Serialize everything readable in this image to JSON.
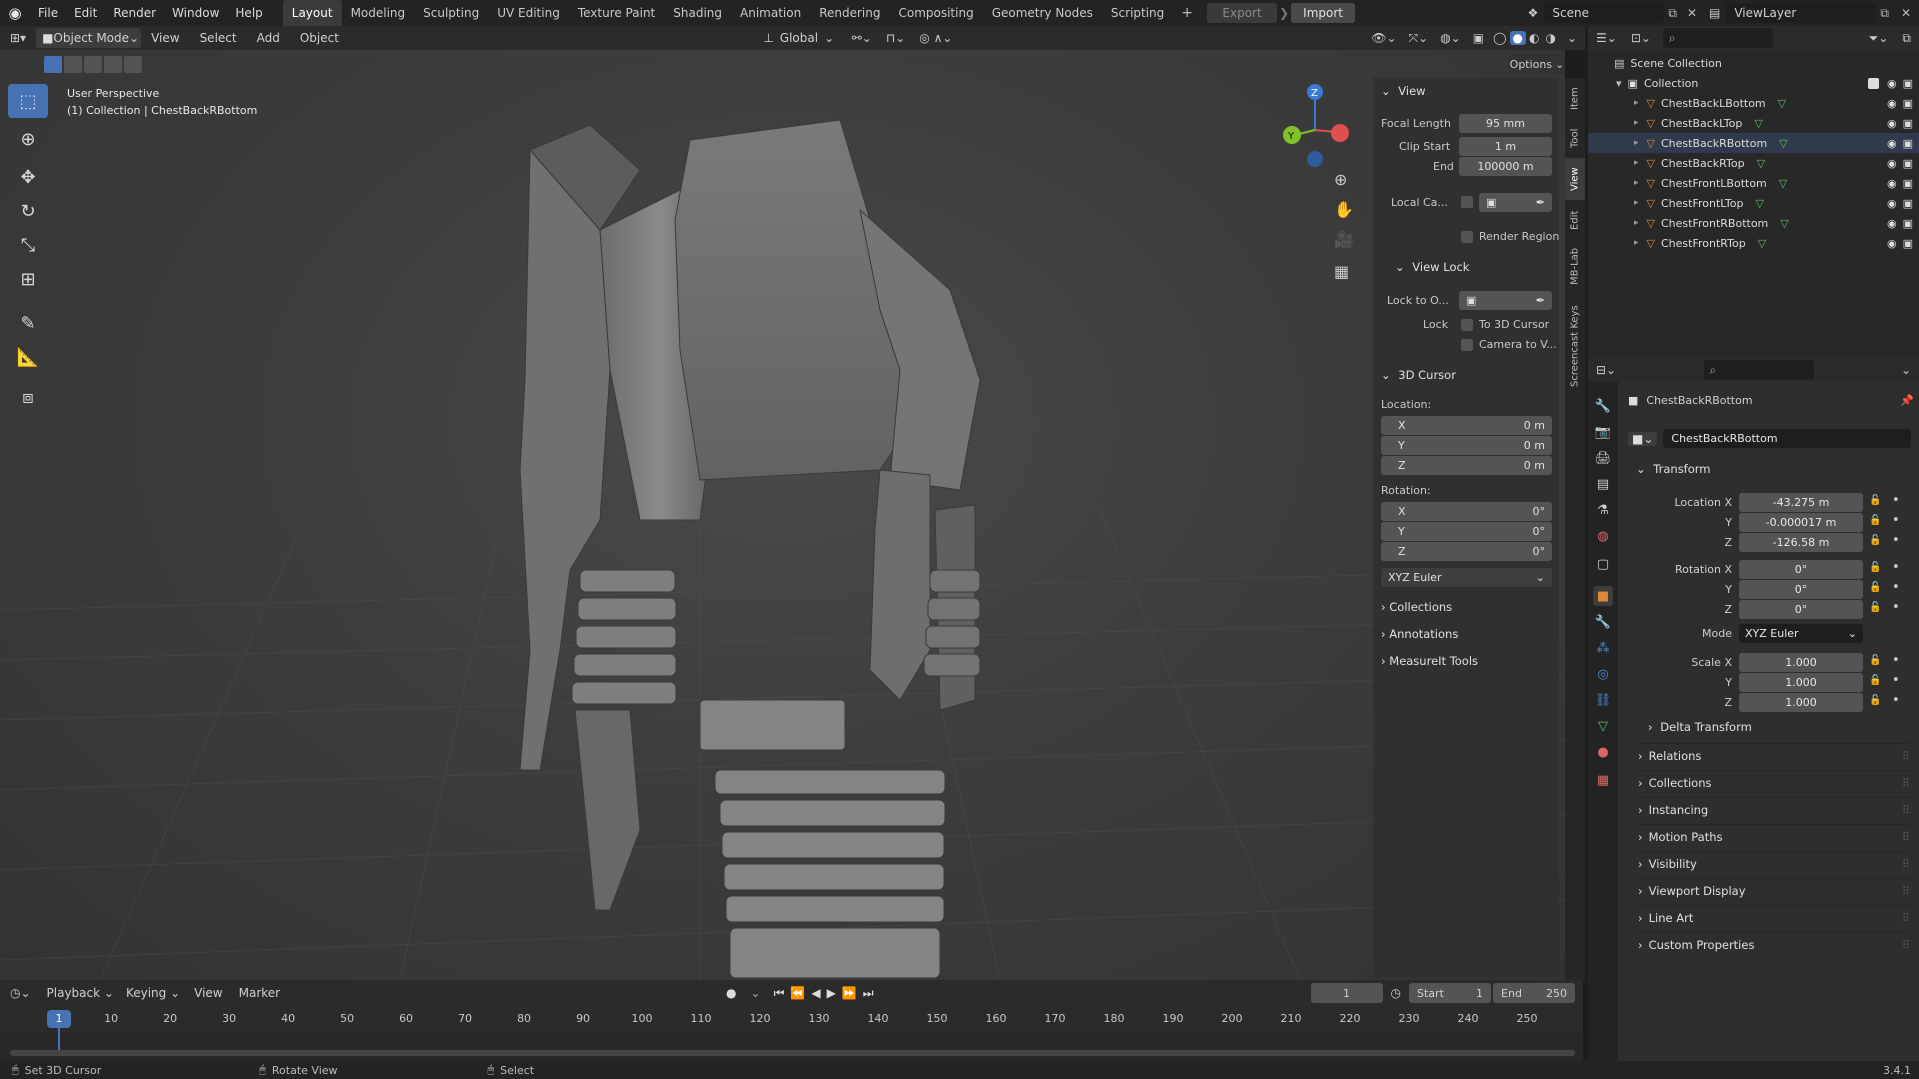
{
  "topbar": {
    "menus": [
      "File",
      "Edit",
      "Render",
      "Window",
      "Help"
    ],
    "workspaces": [
      "Layout",
      "Modeling",
      "Sculpting",
      "UV Editing",
      "Texture Paint",
      "Shading",
      "Animation",
      "Rendering",
      "Compositing",
      "Geometry Nodes",
      "Scripting"
    ],
    "active_workspace": "Layout",
    "export_label": "Export",
    "import_label": "Import",
    "scene": "Scene",
    "view_layer": "ViewLayer"
  },
  "viewport_header": {
    "mode": "Object Mode",
    "menus": [
      "View",
      "Select",
      "Add",
      "Object"
    ],
    "orientation": "Global",
    "options_label": "Options"
  },
  "viewport": {
    "perspective": "User Perspective",
    "context": "(1) Collection | ChestBackRBottom",
    "gizmo_axes": {
      "x": "X",
      "y": "Y",
      "z": "Z"
    }
  },
  "npanel": {
    "tabs": [
      "Item",
      "Tool",
      "View",
      "Edit",
      "MB-Lab",
      "Screencast Keys"
    ],
    "view": {
      "title": "View",
      "focal_length_label": "Focal Length",
      "focal_length": "95 mm",
      "clip_start_label": "Clip Start",
      "clip_start": "1 m",
      "end_label": "End",
      "clip_end": "100000 m",
      "local_camera_label": "Local Ca...",
      "render_region_label": "Render Region"
    },
    "view_lock": {
      "title": "View Lock",
      "lock_to_label": "Lock to O...",
      "lock_label": "Lock",
      "to_3d_cursor": "To 3D Cursor",
      "camera_to_view": "Camera to V..."
    },
    "cursor": {
      "title": "3D Cursor",
      "location_label": "Location:",
      "location": [
        {
          "axis": "X",
          "value": "0 m"
        },
        {
          "axis": "Y",
          "value": "0 m"
        },
        {
          "axis": "Z",
          "value": "0 m"
        }
      ],
      "rotation_label": "Rotation:",
      "rotation": [
        {
          "axis": "X",
          "value": "0°"
        },
        {
          "axis": "Y",
          "value": "0°"
        },
        {
          "axis": "Z",
          "value": "0°"
        }
      ],
      "rotation_mode": "XYZ Euler"
    },
    "collapsed": [
      "Collections",
      "Annotations",
      "MeasureIt Tools"
    ]
  },
  "outliner": {
    "scene_collection": "Scene Collection",
    "collection": "Collection",
    "objects": [
      "ChestBackLBottom",
      "ChestBackLTop",
      "ChestBackRBottom",
      "ChestBackRTop",
      "ChestFrontLBottom",
      "ChestFrontLTop",
      "ChestFrontRBottom",
      "ChestFrontRTop"
    ],
    "active_object": "ChestBackRBottom"
  },
  "properties": {
    "object_name": "ChestBackRBottom",
    "object_field": "ChestBackRBottom",
    "transform_label": "Transform",
    "location": [
      {
        "label": "Location X",
        "value": "-43.275 m"
      },
      {
        "label": "Y",
        "value": "-0.000017 m"
      },
      {
        "label": "Z",
        "value": "-126.58 m"
      }
    ],
    "rotation": [
      {
        "label": "Rotation X",
        "value": "0°"
      },
      {
        "label": "Y",
        "value": "0°"
      },
      {
        "label": "Z",
        "value": "0°"
      }
    ],
    "mode_label": "Mode",
    "mode": "XYZ Euler",
    "scale": [
      {
        "label": "Scale X",
        "value": "1.000"
      },
      {
        "label": "Y",
        "value": "1.000"
      },
      {
        "label": "Z",
        "value": "1.000"
      }
    ],
    "delta_transform": "Delta Transform",
    "sections": [
      "Relations",
      "Collections",
      "Instancing",
      "Motion Paths",
      "Visibility",
      "Viewport Display",
      "Line Art",
      "Custom Properties"
    ]
  },
  "timeline": {
    "menus": [
      "Playback",
      "Keying",
      "View",
      "Marker"
    ],
    "current_frame": "1",
    "start_label": "Start",
    "start": "1",
    "end_label": "End",
    "end": "250",
    "ruler_frames": [
      "10",
      "20",
      "30",
      "40",
      "50",
      "60",
      "70",
      "80",
      "90",
      "100",
      "110",
      "120",
      "130",
      "140",
      "150",
      "160",
      "170",
      "180",
      "190",
      "200",
      "210",
      "220",
      "230",
      "240",
      "250"
    ],
    "playhead_label": "1"
  },
  "statusbar": {
    "items": [
      "Set 3D Cursor",
      "Rotate View",
      "Select"
    ],
    "version": "3.4.1"
  },
  "colors": {
    "accent": "#4772b3",
    "object_orange": "#e0883a",
    "mesh_green": "#5fbd5f",
    "axis_x": "#e04f4f",
    "axis_y": "#82c12a",
    "axis_z": "#3c78d8"
  }
}
